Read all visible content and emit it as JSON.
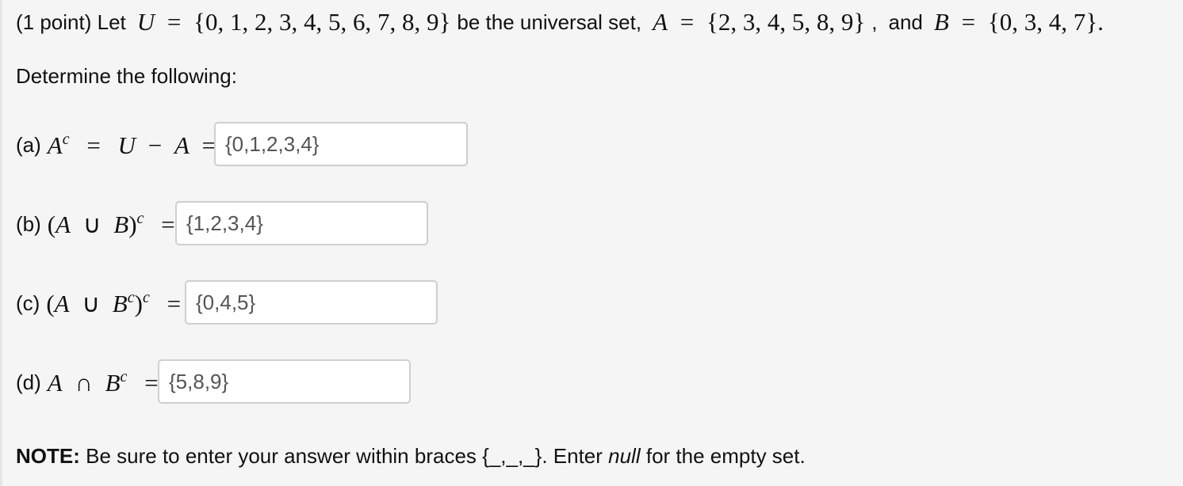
{
  "problem": {
    "points": "(1 point) Let",
    "U_label": "U",
    "U_set": "{0, 1, 2, 3, 4, 5, 6, 7, 8, 9}",
    "universal_text": "be the universal set,",
    "A_label": "A",
    "A_set": "{2, 3, 4, 5, 8, 9}",
    "comma": ",",
    "and_text": "and",
    "B_label": "B",
    "B_set": "{0, 3, 4, 7}.",
    "equals": "="
  },
  "instruction": "Determine the following:",
  "parts": [
    {
      "label": "(a)",
      "answer": "{0,1,2,3,4}"
    },
    {
      "label": "(b)",
      "answer": "{1,2,3,4}"
    },
    {
      "label": "(c)",
      "answer": "{0,4,5}"
    },
    {
      "label": "(d)",
      "answer": "{5,8,9}"
    }
  ],
  "math": {
    "A": "A",
    "B": "B",
    "U": "U",
    "c": "c",
    "eq": "=",
    "minus": "−",
    "union": "∪",
    "intersect": "∩",
    "lparen": "(",
    "rparen": ")"
  },
  "note": {
    "bold": "NOTE:",
    "text1": " Be sure to enter your answer within braces {_,_,_}. Enter ",
    "italic": "null",
    "text2": " for the empty set."
  }
}
